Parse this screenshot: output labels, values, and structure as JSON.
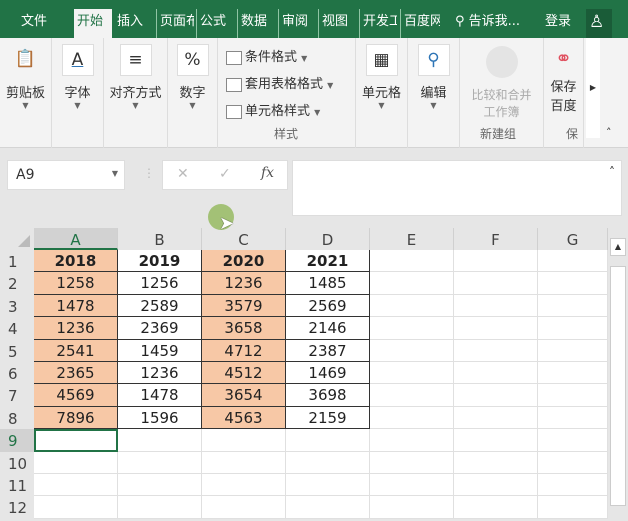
{
  "tabs": [
    "文件",
    "开始",
    "插入",
    "页面布",
    "公式",
    "数据",
    "审阅",
    "视图",
    "开发工",
    "百度网"
  ],
  "tell_me": "告诉我...",
  "login": "登录",
  "ribbon": {
    "clipboard": "剪贴板",
    "font": "字体",
    "align": "对齐方式",
    "number": "数字",
    "cond_format": "条件格式",
    "table_format": "套用表格格式",
    "cell_style": "单元格样式",
    "styles_group": "样式",
    "cells": "单元格",
    "edit": "编辑",
    "compare": "比较和合并",
    "workbook": "工作簿",
    "new_group": "新建组",
    "save": "保存",
    "baidu": "百度",
    "save_group": "保"
  },
  "name_box": "A9",
  "columns": [
    "A",
    "B",
    "C",
    "D",
    "E",
    "F",
    "G"
  ],
  "rows": [
    "1",
    "2",
    "3",
    "4",
    "5",
    "6",
    "7",
    "8",
    "9",
    "10",
    "11",
    "12"
  ],
  "table": [
    [
      "2018",
      "2019",
      "2020",
      "2021"
    ],
    [
      "1258",
      "1256",
      "1236",
      "1485"
    ],
    [
      "1478",
      "2589",
      "3579",
      "2569"
    ],
    [
      "1236",
      "2369",
      "3658",
      "2146"
    ],
    [
      "2541",
      "1459",
      "4712",
      "2387"
    ],
    [
      "2365",
      "1236",
      "4512",
      "1469"
    ],
    [
      "4569",
      "1478",
      "3654",
      "3698"
    ],
    [
      "7896",
      "1596",
      "4563",
      "2159"
    ]
  ],
  "colors": {
    "accent": "#217346",
    "highlight": "#f7c8a6"
  }
}
